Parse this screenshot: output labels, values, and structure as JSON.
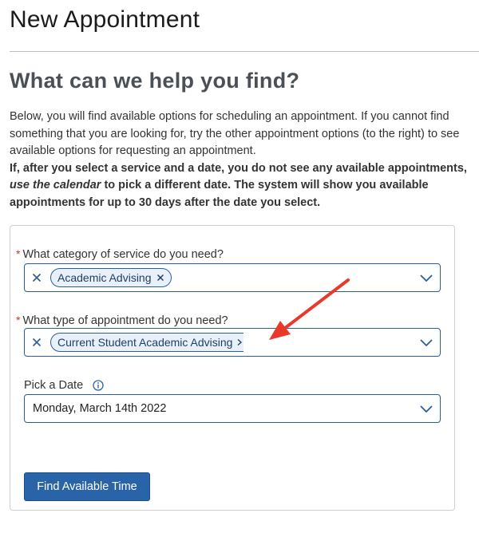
{
  "page": {
    "title": "New Appointment",
    "heading": "What can we help you find?"
  },
  "intro": {
    "paragraph": "Below, you will find available options for scheduling an appointment. If you cannot find something that you are looking for, try the other appointment options (to the right) to see available options for  requesting an appointment.",
    "bold_part1": "If, after you select a service and a date, you do not see any available appointments,",
    "bold_italic": "use the calendar",
    "bold_part2": "to pick a different date.  The system will show you available appointments for up to 30 days after the date you select."
  },
  "form": {
    "category": {
      "required_mark": "*",
      "label": "What category of service do you need?",
      "selected_chip": "Academic Advising",
      "icon": "chevron-down-icon"
    },
    "appointment_type": {
      "required_mark": "*",
      "label": "What type of appointment do you need?",
      "selected_chip": "Current Student Academic Advising",
      "icon": "chevron-down-icon"
    },
    "date": {
      "label": "Pick a Date",
      "value": "Monday, March 14th 2022",
      "info_icon": "info-icon"
    },
    "submit_label": "Find Available Time"
  },
  "colors": {
    "accent": "#2a64a8",
    "annotation_arrow": "#e8392b",
    "required": "#c0392b"
  }
}
